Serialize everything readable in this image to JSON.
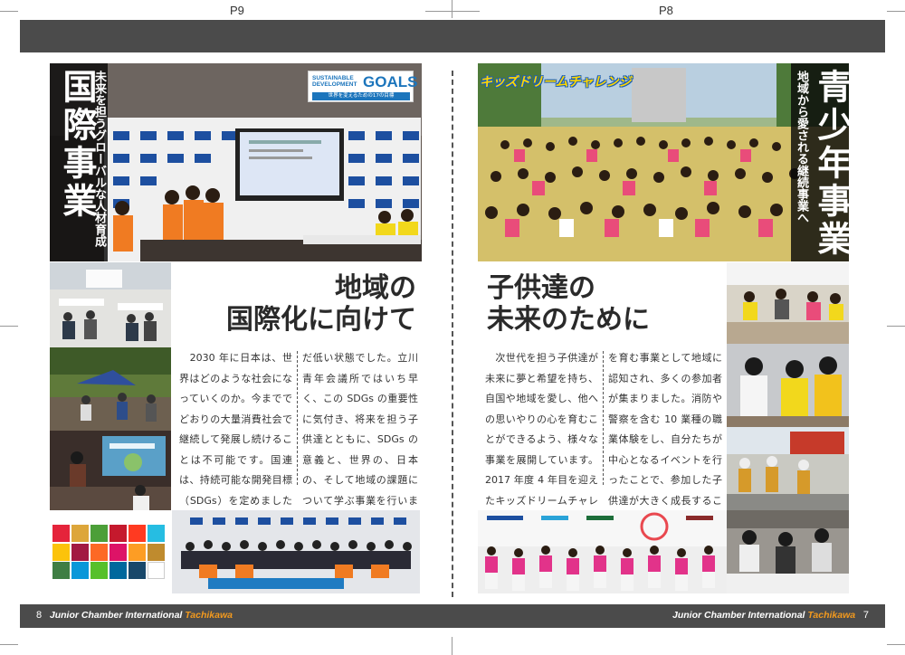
{
  "page_labels": {
    "left": "P9",
    "right": "P8"
  },
  "footer": {
    "left_page_number": "8",
    "left_org": "Junior Chamber International ",
    "left_city": "Tachikawa",
    "right_org": "Junior Chamber International ",
    "right_city": "Tachikawa",
    "right_page_number": "7"
  },
  "left_page": {
    "title": "国際事業",
    "subtitle": "未来を担うグローバルな人材育成",
    "badge": {
      "line1": "SUSTAINABLE",
      "line2": "DEVELOPMENT",
      "goals": "GOALS",
      "tagline": "世界を変えるための17の目標"
    },
    "heading_line1": "地域の",
    "heading_line2": "国際化に向けて",
    "body_col1": "　2030 年に日本は、世界はどのような社会になっていくのか。今まででどおりの大量消費社会で継続して発展し続けることは不可能です。国連は、持続可能な開発目標（SDGs）を定めましたが、その知名度はまだま",
    "body_col2": "だ低い状態でした。立川青年会議所ではいち早く、この SDGs の重要性に気付き、将来を担う子供達とともに、SDGs の意義と、世界の、日本の、そして地域の課題について学ぶ事業を行いました。",
    "colors": [
      "#e5243b",
      "#dda63a",
      "#4c9f38",
      "#c5192d",
      "#ff3a21",
      "#26bde2",
      "#fcc30b",
      "#a21942",
      "#fd6925",
      "#dd1367",
      "#fd9d24",
      "#bf8b2e",
      "#3f7e44",
      "#0a97d9",
      "#56c02b",
      "#00689d",
      "#19486a",
      "#ffffff"
    ]
  },
  "right_page": {
    "title": "青少年事業",
    "subtitle": "地域から愛される継続事業へ",
    "logo": "キッズドリームチャレンジ",
    "heading_line1": "子供達の",
    "heading_line2": "未来のために",
    "body_col1": "　次世代を担う子供達が未来に夢と希望を持ち、自国や地域を愛し、他への思いやりの心を育むことができるよう、様々な事業を展開しています。2017 年度 4 年目を迎えたキッズドリームチャレンジは、地域企業の協力のもと、「自己肯定感」「地域愛」",
    "body_col2": "を育む事業として地域に認知され、多くの参加者が集まりました。消防や警察を含む 10 業種の職業体験をし、自分たちが中心となるイベントを行ったことで、参加した子供達が大きく成長することができました。"
  }
}
